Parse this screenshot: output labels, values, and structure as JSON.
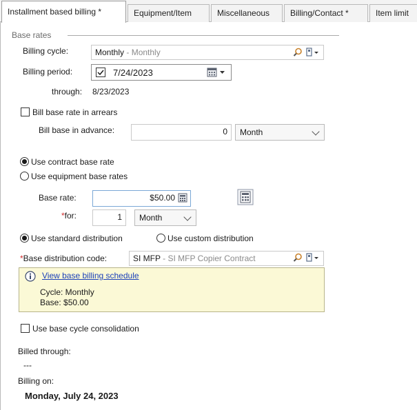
{
  "tabs": [
    {
      "label": "Installment based billing *",
      "active": true
    },
    {
      "label": "Equipment/Item",
      "active": false
    },
    {
      "label": "Miscellaneous",
      "active": false
    },
    {
      "label": "Billing/Contact *",
      "active": false
    },
    {
      "label": "Item limit",
      "active": false
    }
  ],
  "base_rates": {
    "legend": "Base rates",
    "billing_cycle_label": "Billing cycle:",
    "billing_cycle_value": "Monthly",
    "billing_cycle_desc": " - Monthly",
    "billing_period_label": "Billing period:",
    "billing_period_value": "7/24/2023",
    "billing_period_checked": true,
    "through_label": "through:",
    "through_value": "8/23/2023",
    "arrears_label": "Bill base rate in arrears",
    "arrears_checked": false,
    "advance_label": "Bill base in advance:",
    "advance_value": "0",
    "advance_unit": "Month",
    "use_contract_label": "Use contract base rate",
    "use_equipment_label": "Use equipment base rates",
    "rate_source": "contract",
    "base_rate_label": "Base rate:",
    "base_rate_value": "$50.00",
    "for_label": "for:",
    "for_value": "1",
    "for_unit": "Month",
    "standard_dist_label": "Use standard distribution",
    "custom_dist_label": "Use custom distribution",
    "distribution": "standard",
    "dist_code_label": "Base distribution code:",
    "dist_code_value": "SI MFP",
    "dist_code_desc": " - SI MFP Copier Contract",
    "info_link": "View base billing schedule",
    "info_cycle": "Cycle: Monthly",
    "info_base": "Base: $50.00",
    "consolidation_label": "Use base cycle consolidation",
    "consolidation_checked": false,
    "billed_through_label": "Billed through:",
    "billed_through_value": "---",
    "billing_on_label": "Billing on:",
    "billing_on_value": "Monday, July 24, 2023"
  },
  "icons": [
    "search-icon",
    "link-dropdown-icon",
    "calendar-dropdown-icon",
    "calculator-icon",
    "info-icon",
    "chevron-down-icon"
  ],
  "colors": {
    "required": "#d12b2b",
    "link": "#1a3fb8",
    "info_bg": "#fbf9d6"
  }
}
